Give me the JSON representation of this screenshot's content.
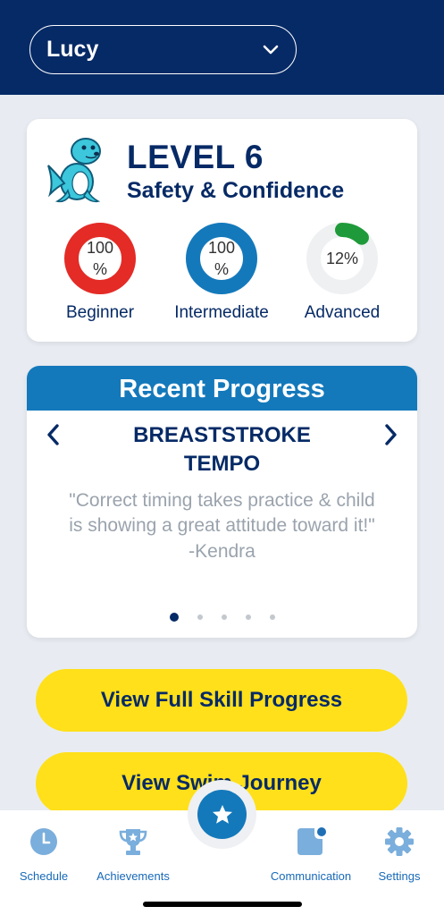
{
  "header": {
    "child_name": "Lucy",
    "dropdown_icon": "chevron-down-icon"
  },
  "level": {
    "title": "LEVEL 6",
    "subtitle": "Safety & Confidence",
    "mascot": "seal-mascot",
    "rings": [
      {
        "percent_text": "100\n%",
        "label": "Beginner",
        "value": 1.0,
        "color": "#e42b26"
      },
      {
        "percent_text": "100\n%",
        "label": "Intermediate",
        "value": 1.0,
        "color": "#1479bb"
      },
      {
        "percent_text": "12%",
        "label": "Advanced",
        "value": 0.12,
        "color": "#1f9a3a"
      }
    ]
  },
  "recent": {
    "heading": "Recent Progress",
    "skill_line1": "BREASTSTROKE",
    "skill_line2": "TEMPO",
    "quote_line1": "\"Correct timing takes practice & child",
    "quote_line2": "is showing a great attitude toward it!\"",
    "author": "-Kendra",
    "page_count": 5,
    "active_page": 1
  },
  "buttons": {
    "full_progress": "View Full Skill Progress",
    "swim_journey": "View Swim Journey"
  },
  "tabs": [
    {
      "label": "Schedule",
      "icon": "clock-icon"
    },
    {
      "label": "Achievements",
      "icon": "trophy-icon"
    },
    {
      "label": "Communication",
      "icon": "message-icon"
    },
    {
      "label": "Settings",
      "icon": "gear-icon"
    }
  ],
  "fab_icon": "star-icon",
  "colors": {
    "navy": "#062a66",
    "blue": "#1479bb",
    "yellow": "#ffe01a",
    "tab_blue": "#1769b8"
  }
}
